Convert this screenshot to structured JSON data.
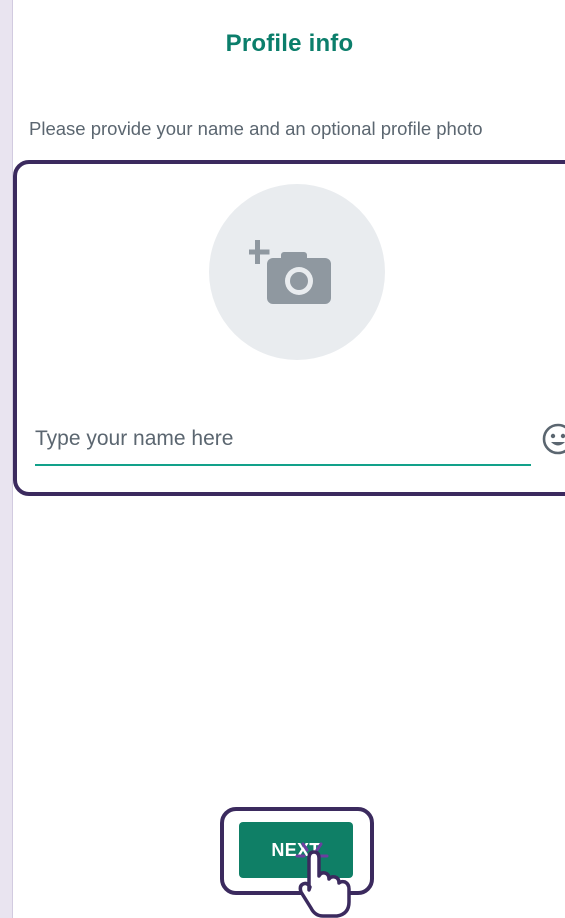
{
  "header": {
    "title": "Profile info"
  },
  "main": {
    "subtitle": "Please provide your name and an optional profile photo",
    "photo_icon": "add-camera-icon",
    "name_input": {
      "placeholder": "Type your name here",
      "value": ""
    },
    "emoji_icon": "emoji-icon"
  },
  "footer": {
    "next_label": "NEXT"
  },
  "colors": {
    "accent": "#0b7e6b",
    "button": "#0f7f66",
    "underline": "#12a18a",
    "highlight": "#3b2a5e",
    "placeholder_circle": "#e9ecef",
    "icon_gray": "#8f98a0"
  }
}
